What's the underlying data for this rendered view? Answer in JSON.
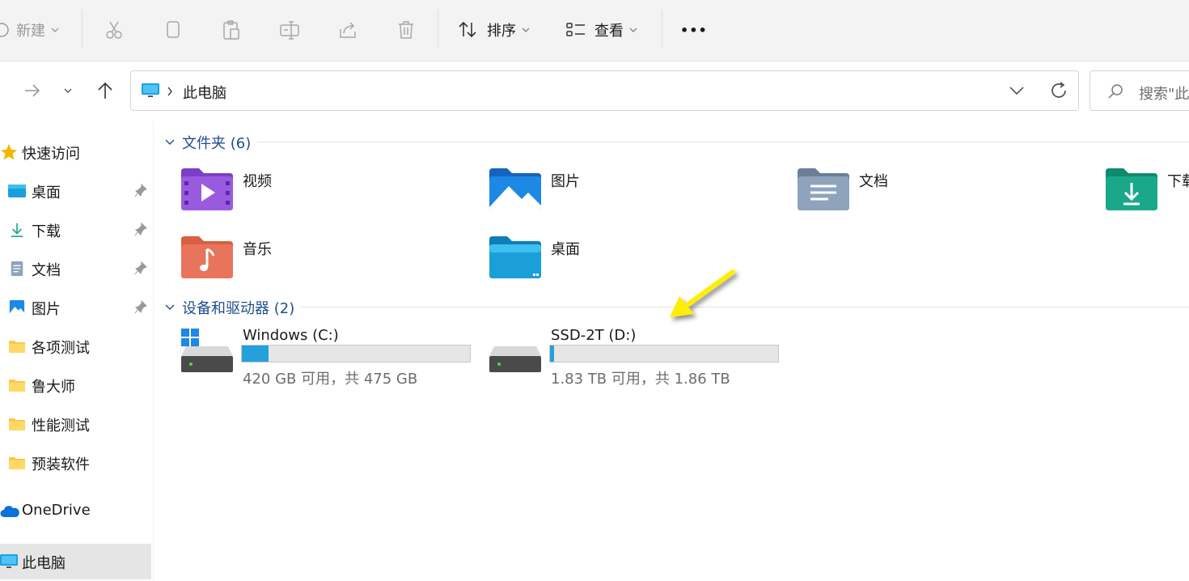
{
  "toolbar": {
    "new_label": "新建",
    "sort_label": "排序",
    "view_label": "查看",
    "more_label": "•••"
  },
  "address": {
    "location": "此电脑",
    "search_placeholder": "搜索\"此"
  },
  "sidebar": {
    "quick_access": "快速访问",
    "items": [
      {
        "label": "桌面",
        "pinned": true
      },
      {
        "label": "下载",
        "pinned": true
      },
      {
        "label": "文档",
        "pinned": true
      },
      {
        "label": "图片",
        "pinned": true
      },
      {
        "label": "各项测试",
        "pinned": false
      },
      {
        "label": "鲁大师",
        "pinned": false
      },
      {
        "label": "性能测试",
        "pinned": false
      },
      {
        "label": "预装软件",
        "pinned": false
      }
    ],
    "onedrive": "OneDrive",
    "this_pc": "此电脑"
  },
  "folders_section": {
    "header": "文件夹 (6)",
    "items": [
      {
        "label": "视频",
        "icon": "video-folder-icon",
        "color": "#8e44d9"
      },
      {
        "label": "图片",
        "icon": "pictures-folder-icon",
        "color": "#1e88e5"
      },
      {
        "label": "文档",
        "icon": "documents-folder-icon",
        "color": "#7f93ad"
      },
      {
        "label": "下载",
        "icon": "downloads-folder-icon",
        "color": "#1aa88a"
      },
      {
        "label": "音乐",
        "icon": "music-folder-icon",
        "color": "#e8745c"
      },
      {
        "label": "桌面",
        "icon": "desktop-folder-icon",
        "color": "#1b9fd8"
      }
    ]
  },
  "drives_section": {
    "header": "设备和驱动器 (2)",
    "drives": [
      {
        "name": "Windows  (C:)",
        "free_text": "420 GB 可用，共 475 GB",
        "used_fraction": 0.116
      },
      {
        "name": "SSD-2T (D:)",
        "free_text": "1.83 TB 可用，共 1.86 TB",
        "used_fraction": 0.016
      }
    ]
  },
  "colors": {
    "accent": "#26a0da",
    "section_header": "#1f4e8c",
    "annotation_arrow": "#ffee00"
  }
}
